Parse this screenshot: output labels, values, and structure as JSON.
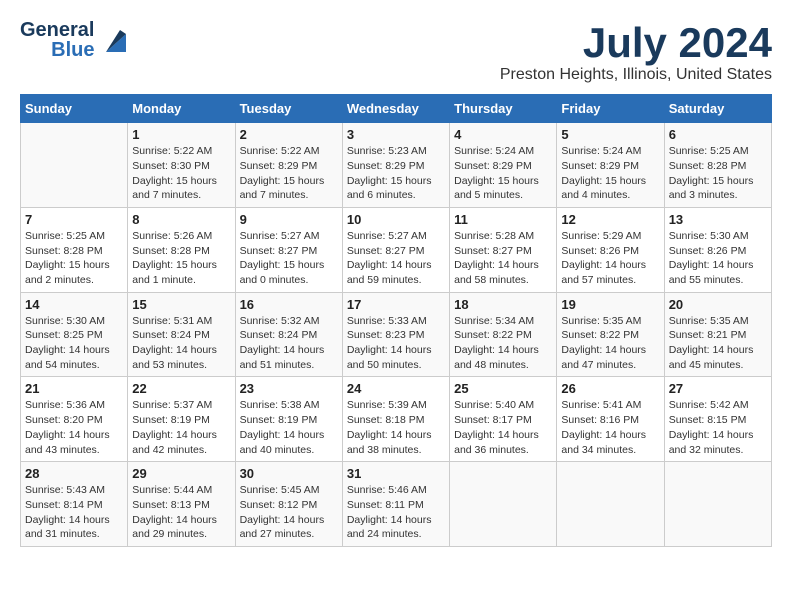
{
  "header": {
    "logo_general": "General",
    "logo_blue": "Blue",
    "title": "July 2024",
    "subtitle": "Preston Heights, Illinois, United States"
  },
  "calendar": {
    "days_of_week": [
      "Sunday",
      "Monday",
      "Tuesday",
      "Wednesday",
      "Thursday",
      "Friday",
      "Saturday"
    ],
    "weeks": [
      [
        {
          "num": "",
          "info": ""
        },
        {
          "num": "1",
          "info": "Sunrise: 5:22 AM\nSunset: 8:30 PM\nDaylight: 15 hours\nand 7 minutes."
        },
        {
          "num": "2",
          "info": "Sunrise: 5:22 AM\nSunset: 8:29 PM\nDaylight: 15 hours\nand 7 minutes."
        },
        {
          "num": "3",
          "info": "Sunrise: 5:23 AM\nSunset: 8:29 PM\nDaylight: 15 hours\nand 6 minutes."
        },
        {
          "num": "4",
          "info": "Sunrise: 5:24 AM\nSunset: 8:29 PM\nDaylight: 15 hours\nand 5 minutes."
        },
        {
          "num": "5",
          "info": "Sunrise: 5:24 AM\nSunset: 8:29 PM\nDaylight: 15 hours\nand 4 minutes."
        },
        {
          "num": "6",
          "info": "Sunrise: 5:25 AM\nSunset: 8:28 PM\nDaylight: 15 hours\nand 3 minutes."
        }
      ],
      [
        {
          "num": "7",
          "info": "Sunrise: 5:25 AM\nSunset: 8:28 PM\nDaylight: 15 hours\nand 2 minutes."
        },
        {
          "num": "8",
          "info": "Sunrise: 5:26 AM\nSunset: 8:28 PM\nDaylight: 15 hours\nand 1 minute."
        },
        {
          "num": "9",
          "info": "Sunrise: 5:27 AM\nSunset: 8:27 PM\nDaylight: 15 hours\nand 0 minutes."
        },
        {
          "num": "10",
          "info": "Sunrise: 5:27 AM\nSunset: 8:27 PM\nDaylight: 14 hours\nand 59 minutes."
        },
        {
          "num": "11",
          "info": "Sunrise: 5:28 AM\nSunset: 8:27 PM\nDaylight: 14 hours\nand 58 minutes."
        },
        {
          "num": "12",
          "info": "Sunrise: 5:29 AM\nSunset: 8:26 PM\nDaylight: 14 hours\nand 57 minutes."
        },
        {
          "num": "13",
          "info": "Sunrise: 5:30 AM\nSunset: 8:26 PM\nDaylight: 14 hours\nand 55 minutes."
        }
      ],
      [
        {
          "num": "14",
          "info": "Sunrise: 5:30 AM\nSunset: 8:25 PM\nDaylight: 14 hours\nand 54 minutes."
        },
        {
          "num": "15",
          "info": "Sunrise: 5:31 AM\nSunset: 8:24 PM\nDaylight: 14 hours\nand 53 minutes."
        },
        {
          "num": "16",
          "info": "Sunrise: 5:32 AM\nSunset: 8:24 PM\nDaylight: 14 hours\nand 51 minutes."
        },
        {
          "num": "17",
          "info": "Sunrise: 5:33 AM\nSunset: 8:23 PM\nDaylight: 14 hours\nand 50 minutes."
        },
        {
          "num": "18",
          "info": "Sunrise: 5:34 AM\nSunset: 8:22 PM\nDaylight: 14 hours\nand 48 minutes."
        },
        {
          "num": "19",
          "info": "Sunrise: 5:35 AM\nSunset: 8:22 PM\nDaylight: 14 hours\nand 47 minutes."
        },
        {
          "num": "20",
          "info": "Sunrise: 5:35 AM\nSunset: 8:21 PM\nDaylight: 14 hours\nand 45 minutes."
        }
      ],
      [
        {
          "num": "21",
          "info": "Sunrise: 5:36 AM\nSunset: 8:20 PM\nDaylight: 14 hours\nand 43 minutes."
        },
        {
          "num": "22",
          "info": "Sunrise: 5:37 AM\nSunset: 8:19 PM\nDaylight: 14 hours\nand 42 minutes."
        },
        {
          "num": "23",
          "info": "Sunrise: 5:38 AM\nSunset: 8:19 PM\nDaylight: 14 hours\nand 40 minutes."
        },
        {
          "num": "24",
          "info": "Sunrise: 5:39 AM\nSunset: 8:18 PM\nDaylight: 14 hours\nand 38 minutes."
        },
        {
          "num": "25",
          "info": "Sunrise: 5:40 AM\nSunset: 8:17 PM\nDaylight: 14 hours\nand 36 minutes."
        },
        {
          "num": "26",
          "info": "Sunrise: 5:41 AM\nSunset: 8:16 PM\nDaylight: 14 hours\nand 34 minutes."
        },
        {
          "num": "27",
          "info": "Sunrise: 5:42 AM\nSunset: 8:15 PM\nDaylight: 14 hours\nand 32 minutes."
        }
      ],
      [
        {
          "num": "28",
          "info": "Sunrise: 5:43 AM\nSunset: 8:14 PM\nDaylight: 14 hours\nand 31 minutes."
        },
        {
          "num": "29",
          "info": "Sunrise: 5:44 AM\nSunset: 8:13 PM\nDaylight: 14 hours\nand 29 minutes."
        },
        {
          "num": "30",
          "info": "Sunrise: 5:45 AM\nSunset: 8:12 PM\nDaylight: 14 hours\nand 27 minutes."
        },
        {
          "num": "31",
          "info": "Sunrise: 5:46 AM\nSunset: 8:11 PM\nDaylight: 14 hours\nand 24 minutes."
        },
        {
          "num": "",
          "info": ""
        },
        {
          "num": "",
          "info": ""
        },
        {
          "num": "",
          "info": ""
        }
      ]
    ]
  }
}
